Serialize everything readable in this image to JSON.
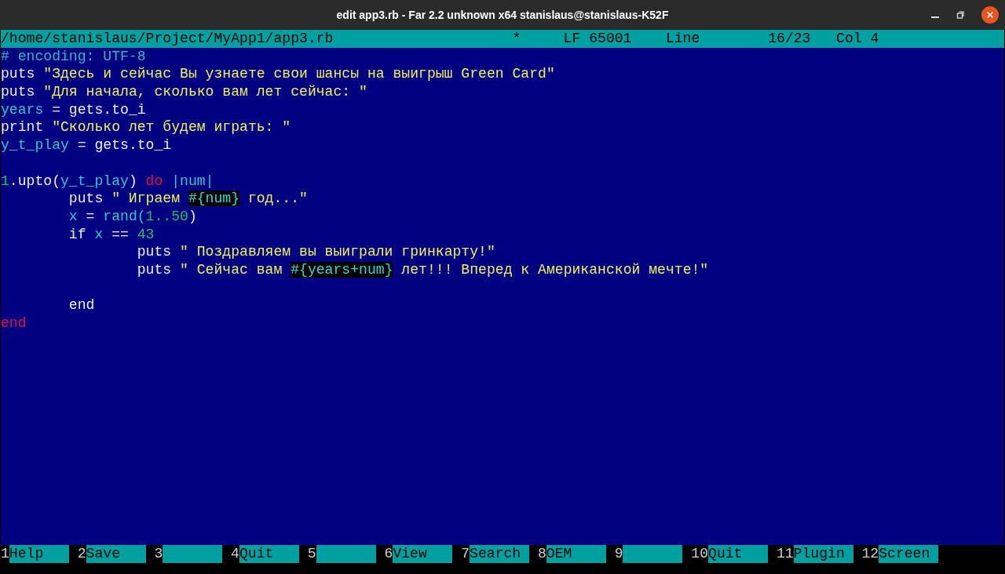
{
  "window": {
    "title": "edit app3.rb - Far 2.2 unknown x64 stanislaus@stanislaus-K52F"
  },
  "status_bar": {
    "path": "/home/stanislaus/Project/MyApp1/app3.rb",
    "modified": "*",
    "encoding": "LF 65001",
    "line_label": "Line",
    "position": "16/23",
    "column": "Col 4"
  },
  "lines": [
    {
      "kind": "code",
      "tokens": [
        {
          "kind": "comment",
          "text": "# encoding: UTF-8"
        }
      ]
    },
    {
      "kind": "code",
      "tokens": [
        {
          "kind": "plain",
          "text": "puts "
        },
        {
          "kind": "string",
          "text": "\"Здесь и сейчас Вы узнаете свои шансы на выигрыш Green Card\""
        }
      ]
    },
    {
      "kind": "code",
      "tokens": [
        {
          "kind": "plain",
          "text": "puts "
        },
        {
          "kind": "string",
          "text": "\"Для начала, сколько вам лет сейчас: \""
        }
      ]
    },
    {
      "kind": "code",
      "tokens": [
        {
          "kind": "var",
          "text": "years"
        },
        {
          "kind": "plain",
          "text": " = gets.to_i"
        }
      ]
    },
    {
      "kind": "code",
      "tokens": [
        {
          "kind": "plain",
          "text": "print "
        },
        {
          "kind": "string",
          "text": "\"Сколько лет будем играть: \""
        }
      ]
    },
    {
      "kind": "code",
      "tokens": [
        {
          "kind": "var",
          "text": "y_t_play"
        },
        {
          "kind": "plain",
          "text": " = gets.to_i"
        }
      ]
    },
    {
      "kind": "blank"
    },
    {
      "kind": "code",
      "tokens": [
        {
          "kind": "number",
          "text": "1"
        },
        {
          "kind": "plain",
          "text": ".upto("
        },
        {
          "kind": "var",
          "text": "y_t_play"
        },
        {
          "kind": "plain",
          "text": ") "
        },
        {
          "kind": "keyword",
          "text": "do"
        },
        {
          "kind": "var",
          "text": " |num|"
        }
      ]
    },
    {
      "kind": "code",
      "tokens": [
        {
          "kind": "plain",
          "text": "        puts "
        },
        {
          "kind": "string",
          "text": "\" Играем "
        },
        {
          "kind": "interp",
          "text": "#{num}"
        },
        {
          "kind": "string",
          "text": " год...\""
        }
      ]
    },
    {
      "kind": "code",
      "tokens": [
        {
          "kind": "var",
          "text": "        x"
        },
        {
          "kind": "plain",
          "text": " = "
        },
        {
          "kind": "var",
          "text": "rand("
        },
        {
          "kind": "number",
          "text": "1..50"
        },
        {
          "kind": "plain",
          "text": ")"
        }
      ]
    },
    {
      "kind": "code",
      "tokens": [
        {
          "kind": "plain",
          "text": "        if "
        },
        {
          "kind": "var",
          "text": "x"
        },
        {
          "kind": "plain",
          "text": " == "
        },
        {
          "kind": "number",
          "text": "43"
        }
      ]
    },
    {
      "kind": "code",
      "tokens": [
        {
          "kind": "plain",
          "text": "                puts "
        },
        {
          "kind": "string",
          "text": "\" Поздравляем вы выиграли гринкарту!\""
        }
      ]
    },
    {
      "kind": "code",
      "tokens": [
        {
          "kind": "plain",
          "text": "                puts "
        },
        {
          "kind": "string",
          "text": "\" Сейчас вам "
        },
        {
          "kind": "interp",
          "text": "#{years+num}"
        },
        {
          "kind": "string",
          "text": " лет!!! Вперед к Американской мечте!\""
        }
      ]
    },
    {
      "kind": "blank"
    },
    {
      "kind": "code",
      "tokens": [
        {
          "kind": "plain",
          "text": "        end"
        }
      ]
    },
    {
      "kind": "code",
      "tokens": [
        {
          "kind": "keyword",
          "text": "end"
        }
      ]
    }
  ],
  "keybar": [
    {
      "key": "1",
      "label": "Help"
    },
    {
      "key": "2",
      "label": "Save"
    },
    {
      "key": "3"
    },
    {
      "key": "4",
      "label": "Quit"
    },
    {
      "key": "5"
    },
    {
      "key": "6",
      "label": "View"
    },
    {
      "key": "7",
      "label": "Search"
    },
    {
      "key": "8",
      "label": "OEM"
    },
    {
      "key": "9"
    },
    {
      "key": "10",
      "label": "Quit"
    },
    {
      "key": "11",
      "label": "Plugin"
    },
    {
      "key": "12",
      "label": "Screen"
    }
  ]
}
